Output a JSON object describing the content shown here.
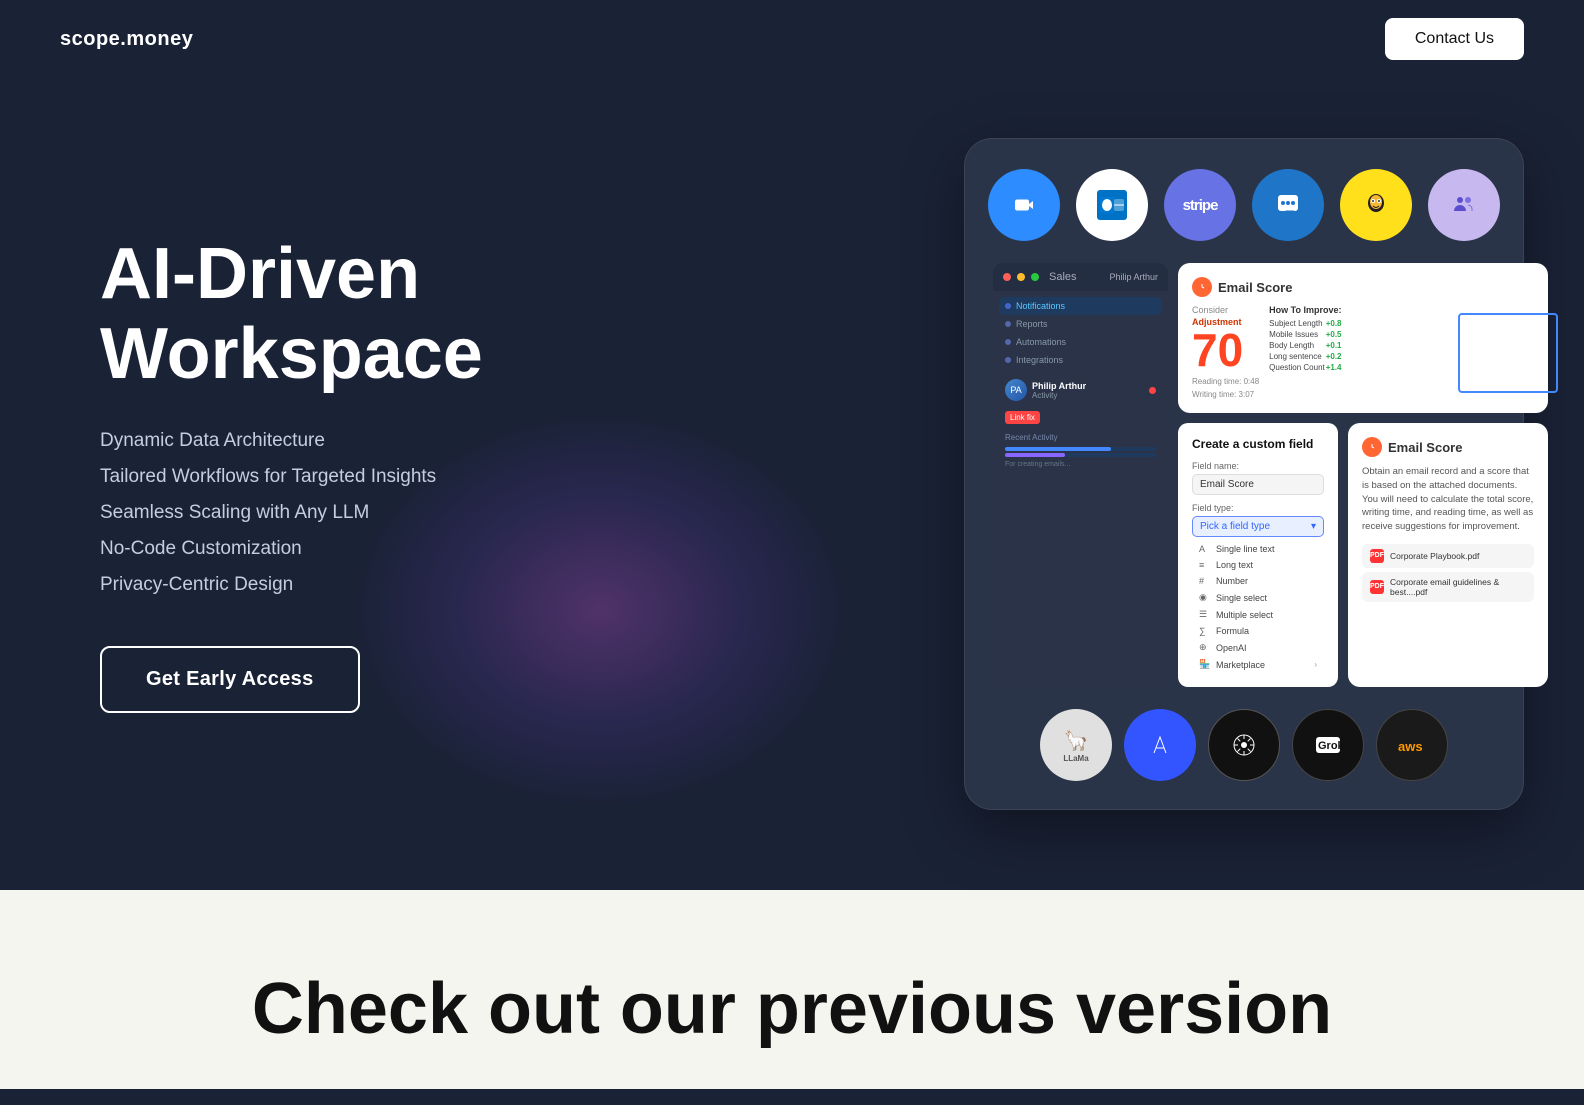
{
  "nav": {
    "logo": "scope.money",
    "contact_btn": "Contact Us"
  },
  "hero": {
    "title_line1": "AI-Driven",
    "title_line2": "Workspace",
    "features": [
      "Dynamic Data Architecture",
      "Tailored Workflows for Targeted Insights",
      "Seamless Scaling with Any LLM",
      "No-Code Customization",
      "Privacy-Centric Design"
    ],
    "cta_btn": "Get Early Access"
  },
  "workspace_card": {
    "top_icons": [
      {
        "label": "Zoom",
        "class": "ic-zoom",
        "symbol": "📹"
      },
      {
        "label": "Outlook",
        "class": "ic-outlook",
        "symbol": "📧"
      },
      {
        "label": "Stripe",
        "class": "ic-stripe",
        "symbol": "stripe"
      },
      {
        "label": "Intercom",
        "class": "ic-intercom",
        "symbol": "💬"
      },
      {
        "label": "Mailchimp",
        "class": "ic-mailchimp",
        "symbol": "🐒"
      },
      {
        "label": "Teams",
        "class": "ic-teams",
        "symbol": "🟣"
      }
    ],
    "email_score": {
      "title": "Email Score",
      "consider": "Consider",
      "adjustment": "Adjustment",
      "score": "70",
      "reading_time": "Reading time: 0:48",
      "writing_time": "Writing time: 3:07",
      "improve_title": "How To Improve:",
      "improve_items": [
        {
          "label": "Subject Length",
          "val": "+0.8"
        },
        {
          "label": "Mobile Issues",
          "val": "+0.5"
        },
        {
          "label": "Body Length",
          "val": "+0.1"
        },
        {
          "label": "Long sentence",
          "val": "+0.2"
        },
        {
          "label": "Question Count",
          "val": "+1.4"
        }
      ]
    },
    "custom_field": {
      "title": "Create a custom field",
      "field_name_label": "Field name:",
      "field_name_value": "Email Score",
      "field_type_label": "Field type:",
      "field_type_placeholder": "Pick a field type",
      "options": [
        {
          "icon": "A",
          "label": "Single line text"
        },
        {
          "icon": "≡",
          "label": "Long text"
        },
        {
          "icon": "#",
          "label": "Number"
        },
        {
          "icon": "◉",
          "label": "Single select"
        },
        {
          "icon": "☰",
          "label": "Multiple select"
        },
        {
          "icon": "∑",
          "label": "Formula"
        },
        {
          "icon": "⊕",
          "label": "OpenAI"
        },
        {
          "icon": "🏪",
          "label": "Marketplace"
        }
      ]
    },
    "email_detail": {
      "title": "Email Score",
      "body": "Obtain an email record and a score that is based on the attached documents. You will need to calculate the total score, writing time, and reading time, as well as receive suggestions for improvement.",
      "docs": [
        "Corporate Playbook.pdf",
        "Corporate email guidelines & best....pdf"
      ]
    },
    "bottom_icons": [
      {
        "label": "LLaMa",
        "class": "bi-llama"
      },
      {
        "label": "Anth",
        "class": "bi-anth",
        "symbol": "A"
      },
      {
        "label": "OpenAI",
        "class": "bi-openai",
        "symbol": "✦"
      },
      {
        "label": "AI Grok",
        "class": "bi-grok",
        "symbol": "Grok"
      },
      {
        "label": "AWS",
        "class": "bi-aws",
        "symbol": "aws"
      }
    ]
  },
  "bottom": {
    "heading": "Check out our previous version"
  }
}
